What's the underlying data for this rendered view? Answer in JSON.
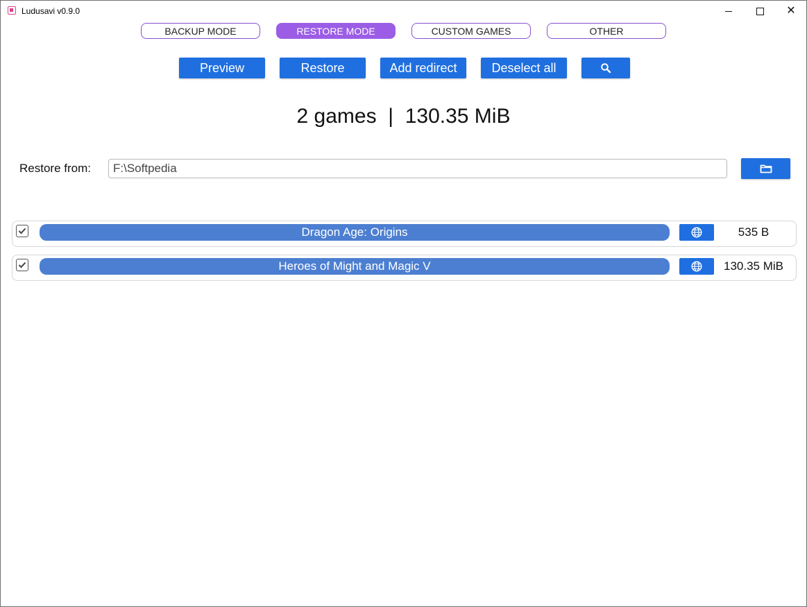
{
  "window": {
    "title": "Ludusavi v0.9.0",
    "icons": {
      "app": "ludusavi-app-icon",
      "minimize": "minimize-icon",
      "maximize": "maximize-icon",
      "close": "close-icon"
    }
  },
  "modes": [
    {
      "label": "BACKUP MODE",
      "active": false
    },
    {
      "label": "RESTORE MODE",
      "active": true
    },
    {
      "label": "CUSTOM GAMES",
      "active": false
    },
    {
      "label": "OTHER",
      "active": false
    }
  ],
  "actions": {
    "preview": "Preview",
    "restore": "Restore",
    "add_redirect": "Add redirect",
    "deselect_all": "Deselect all",
    "search_icon": "search-icon"
  },
  "summary": "2 games  |  130.35 MiB",
  "restore_from": {
    "label": "Restore from:",
    "value": "F:\\Softpedia",
    "browse_icon": "folder-icon"
  },
  "games": [
    {
      "name": "Dragon Age: Origins",
      "size": "535 B",
      "checked": true
    },
    {
      "name": "Heroes of Might and Magic V",
      "size": "130.35 MiB",
      "checked": true
    }
  ],
  "colors": {
    "accent_purple": "#9b5de5",
    "button_blue": "#1f6fe0",
    "row_bar_blue": "#4c7fd1"
  }
}
